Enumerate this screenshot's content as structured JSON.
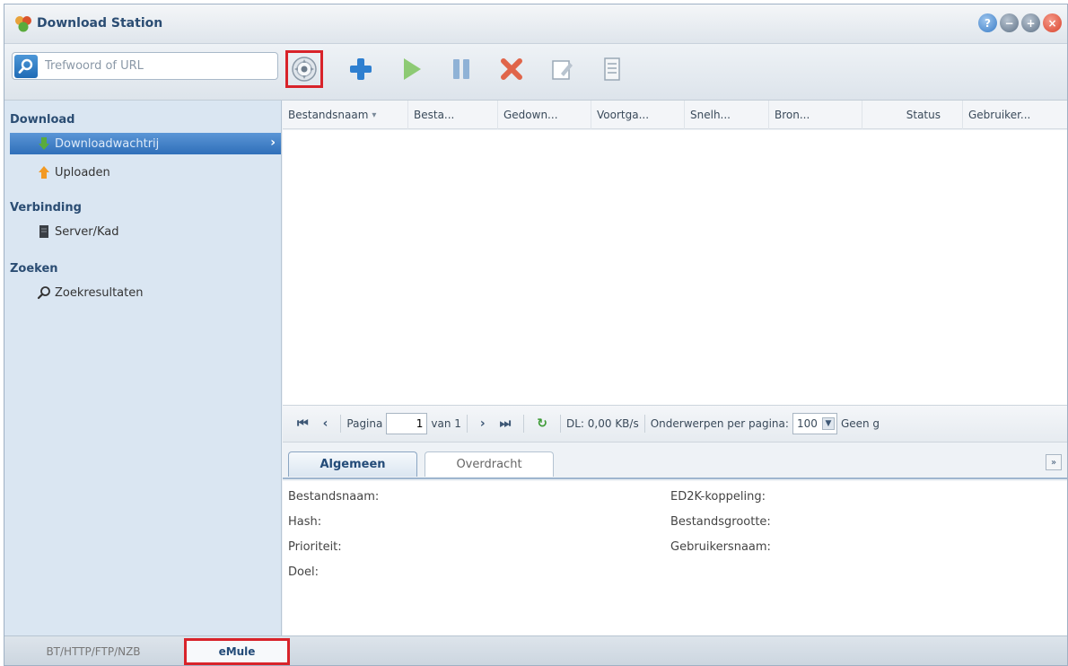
{
  "app": {
    "title": "Download Station",
    "window_buttons": [
      "help",
      "minimize",
      "maximize",
      "close"
    ]
  },
  "search": {
    "placeholder": "Trefwoord of URL"
  },
  "toolbar": {
    "buttons": [
      {
        "name": "settings",
        "icon": "gear-icon",
        "highlighted": true
      },
      {
        "name": "add",
        "icon": "plus-icon"
      },
      {
        "name": "resume",
        "icon": "play-icon"
      },
      {
        "name": "pause",
        "icon": "pause-icon"
      },
      {
        "name": "delete",
        "icon": "delete-x-icon"
      },
      {
        "name": "edit",
        "icon": "edit-icon"
      },
      {
        "name": "clear",
        "icon": "list-icon"
      }
    ]
  },
  "sidebar": {
    "sections": [
      {
        "title": "Download",
        "items": [
          {
            "label": "Downloadwachtrij",
            "icon": "download-queue-icon",
            "active": true
          },
          {
            "label": "Uploaden",
            "icon": "upload-icon",
            "active": false
          }
        ]
      },
      {
        "title": "Verbinding",
        "items": [
          {
            "label": "Server/Kad",
            "icon": "server-icon",
            "active": false
          }
        ]
      },
      {
        "title": "Zoeken",
        "items": [
          {
            "label": "Zoekresultaten",
            "icon": "search-icon",
            "active": false
          }
        ]
      }
    ]
  },
  "grid": {
    "columns": [
      "Bestandsnaam",
      "Besta...",
      "Gedown...",
      "Voortga...",
      "Snelh...",
      "Bron...",
      "Status",
      "Gebruiker..."
    ],
    "rows": []
  },
  "pager": {
    "page_label": "Pagina",
    "page_value": "1",
    "of_label": "van 1",
    "dl_speed": "DL: 0,00 KB/s",
    "per_page_label": "Onderwerpen per pagina:",
    "per_page_value": "100",
    "trailing": "Geen g"
  },
  "detail": {
    "tabs": [
      "Algemeen",
      "Overdracht"
    ],
    "active_tab": "Algemeen",
    "fields_left": [
      "Bestandsnaam:",
      "Hash:",
      "Prioriteit:",
      "Doel:"
    ],
    "fields_right": [
      "ED2K-koppeling:",
      "Bestandsgrootte:",
      "Gebruikersnaam:"
    ]
  },
  "bottom_tabs": [
    {
      "label": "BT/HTTP/FTP/NZB",
      "active": false
    },
    {
      "label": "eMule",
      "active": true
    }
  ],
  "colors": {
    "highlight": "#d8232a",
    "active_nav": "#2f6fb9",
    "title_text": "#2b4d73"
  }
}
